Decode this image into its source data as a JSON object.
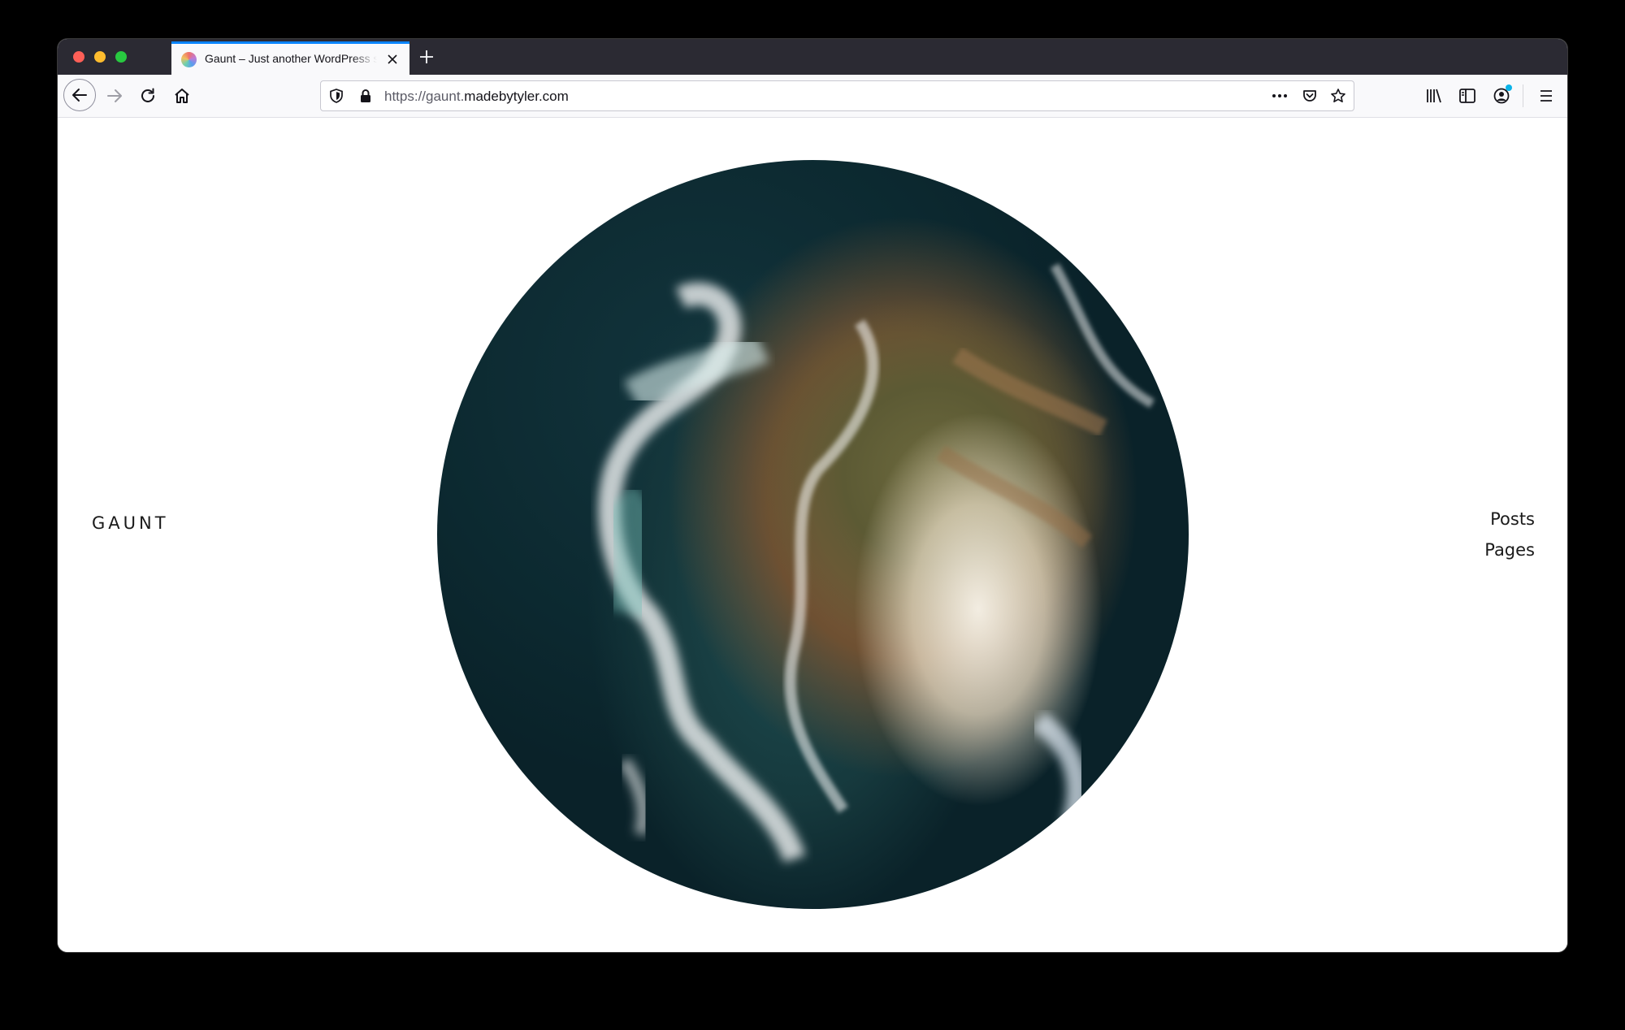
{
  "browser": {
    "tab_title": "Gaunt – Just another WordPress site",
    "url_prefix": "https://gaunt.",
    "url_domain": "madebytyler.com"
  },
  "site": {
    "title": "GAUNT",
    "nav": [
      "Posts",
      "Pages"
    ],
    "hero_image": "aerial photo of ocean waves crashing on rocky coastline"
  },
  "colors": {
    "tab_accent": "#0a84ff",
    "tabstrip_bg": "#2b2a33",
    "account_badge": "#0ab3e8"
  }
}
